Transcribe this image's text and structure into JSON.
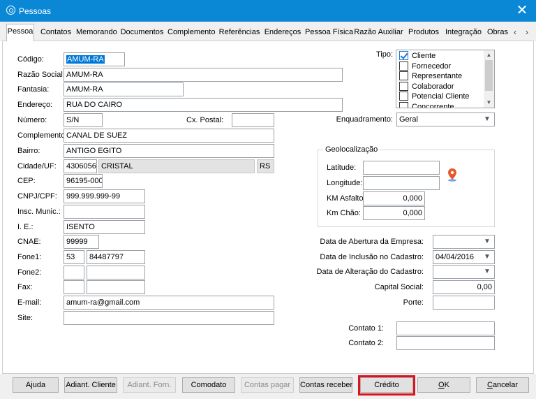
{
  "window": {
    "title": "Pessoas",
    "icon": "chat-bubble-icon",
    "close_label": "✕"
  },
  "tabs": [
    {
      "label": "Pessoa",
      "active": true
    },
    {
      "label": "Contatos"
    },
    {
      "label": "Memorando"
    },
    {
      "label": "Documentos"
    },
    {
      "label": "Complemento"
    },
    {
      "label": "Referências"
    },
    {
      "label": "Endereços"
    },
    {
      "label": "Pessoa Física"
    },
    {
      "label": "Razão Auxiliar"
    },
    {
      "label": "Produtos"
    },
    {
      "label": "Integração"
    },
    {
      "label": "Obras"
    }
  ],
  "tab_scroll": {
    "left": "‹",
    "right": "›"
  },
  "form": {
    "codigo_label": "Código:",
    "codigo_value": "AMUM-RA",
    "razao_label": "Razão Social:",
    "razao_value": "AMUM-RA",
    "fantasia_label": "Fantasia:",
    "fantasia_value": "AMUM-RA",
    "endereco_label": "Endereço:",
    "endereco_value": "RUA DO CAIRO",
    "numero_label": "Número:",
    "numero_value": "S/N",
    "cxpostal_label": "Cx. Postal:",
    "cxpostal_value": "",
    "complemento_label": "Complemento:",
    "complemento_value": "CANAL DE SUEZ",
    "bairro_label": "Bairro:",
    "bairro_value": "ANTIGO EGITO",
    "cidade_label": "Cidade/UF:",
    "cidade_code": "4306056",
    "cidade_name": "CRISTAL",
    "uf": "RS",
    "cep_label": "CEP:",
    "cep_value": "96195-000",
    "cnpj_label": "CNPJ/CPF:",
    "cnpj_value": "999.999.999-99",
    "inscmunic_label": "Insc. Munic.:",
    "inscmunic_value": "",
    "ie_label": "I. E.:",
    "ie_value": "ISENTO",
    "cnae_label": "CNAE:",
    "cnae_value": "99999",
    "fone1_label": "Fone1:",
    "fone1_ddd": "53",
    "fone1_number": "84487797",
    "fone2_label": "Fone2:",
    "fone2_ddd": "",
    "fone2_number": "",
    "fax_label": "Fax:",
    "fax_ddd": "",
    "fax_number": "",
    "email_label": "E-mail:",
    "email_value": "amum-ra@gmail.com",
    "site_label": "Site:",
    "site_value": ""
  },
  "tipo": {
    "label": "Tipo:",
    "items": [
      {
        "label": "Cliente",
        "checked": true
      },
      {
        "label": "Fornecedor",
        "checked": false
      },
      {
        "label": "Representante",
        "checked": false
      },
      {
        "label": "Colaborador",
        "checked": false
      },
      {
        "label": "Potencial Cliente",
        "checked": false
      },
      {
        "label": "Concorrente",
        "checked": false
      }
    ]
  },
  "enquadramento": {
    "label": "Enquadramento:",
    "value": "Geral"
  },
  "geo": {
    "title": "Geolocalização",
    "latitude_label": "Latitude:",
    "latitude_value": "",
    "longitude_label": "Longitude:",
    "longitude_value": "",
    "kmasfalto_label": "KM Asfalto:",
    "kmasfalto_value": "0,000",
    "kmchao_label": "Km Chão:",
    "kmchao_value": "0,000"
  },
  "dates": {
    "abertura_label": "Data de Abertura da Empresa:",
    "abertura_value": "",
    "inclusao_label": "Data de Inclusão no Cadastro:",
    "inclusao_value": "04/04/2016",
    "alteracao_label": "Data de Alteração do Cadastro:",
    "alteracao_value": ""
  },
  "capital_label": "Capital Social:",
  "capital_value": "0,00",
  "porte_label": "Porte:",
  "porte_value": "",
  "contato1_label": "Contato 1:",
  "contato1_value": "",
  "contato2_label": "Contato 2:",
  "contato2_value": "",
  "buttons": {
    "ajuda": "Ajuda",
    "adiant_cliente": "Adiant. Cliente",
    "adiant_forn": "Adiant. Forn.",
    "comodato": "Comodato",
    "contas_pagar": "Contas pagar",
    "contas_receber": "Contas receber",
    "credito": "Crédito",
    "ok_u": "O",
    "ok_rest": "K",
    "cancelar_u": "C",
    "cancelar_rest": "ancelar"
  },
  "colors": {
    "titlebar": "#0a88d6",
    "highlight": "#d9141e",
    "pin": "#e8572a",
    "check": "#1c78d4"
  }
}
